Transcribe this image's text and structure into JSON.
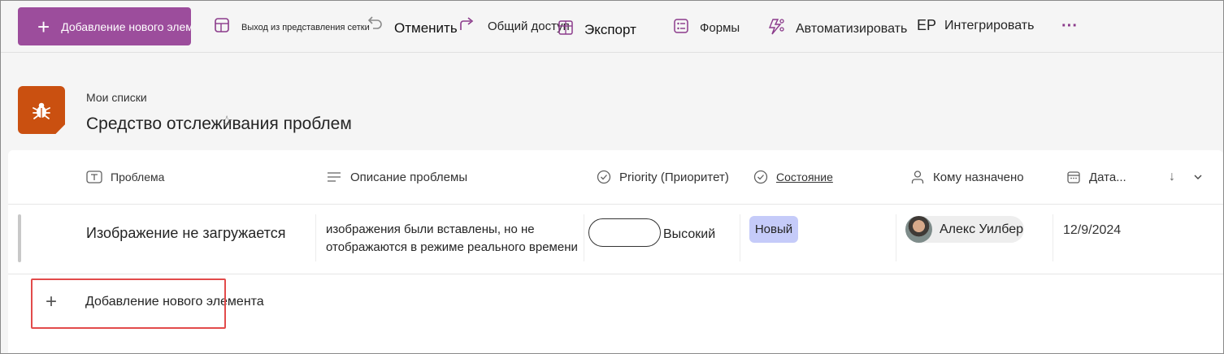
{
  "toolbar": {
    "new_item_label": "Добавление нового элемента",
    "exit_grid_label": "Выход из представления сетки",
    "undo_label": "Отменить",
    "share_label": "Общий доступ",
    "export_label": "Экспорт",
    "forms_label": "Формы",
    "automate_label": "Автоматизировать",
    "integrate_prefix": "EP",
    "integrate_label": "Интегрировать",
    "more_label": "···"
  },
  "header": {
    "breadcrumb": "Мои списки",
    "title": "Средство отслеживания проблем",
    "list_icon": "bug-icon",
    "accent_color": "#ca5010",
    "brand_color": "#9c4d9c"
  },
  "columns": [
    {
      "label": "Проблема",
      "icon": "text-type-icon"
    },
    {
      "label": "Описание проблемы",
      "icon": "lines-icon"
    },
    {
      "label": "Priority (Приоритет)",
      "icon": "check-circle-icon"
    },
    {
      "label": "Состояние",
      "icon": "check-circle-icon"
    },
    {
      "label": "Кому назначено",
      "icon": "person-icon"
    },
    {
      "label": "Дата...",
      "icon": "calendar-icon"
    }
  ],
  "rows": [
    {
      "issue": "Изображение не загружается",
      "description": "изображения были вставлены, но не отображаются в режиме реального времени",
      "priority": "Высокий",
      "status": "Новый",
      "status_color": "#c5cbf9",
      "assigned_to": "Алекс Уилбер",
      "date": "12/9/2024"
    }
  ],
  "add_row": {
    "plus": "+",
    "label": "Добавление нового элемента"
  }
}
